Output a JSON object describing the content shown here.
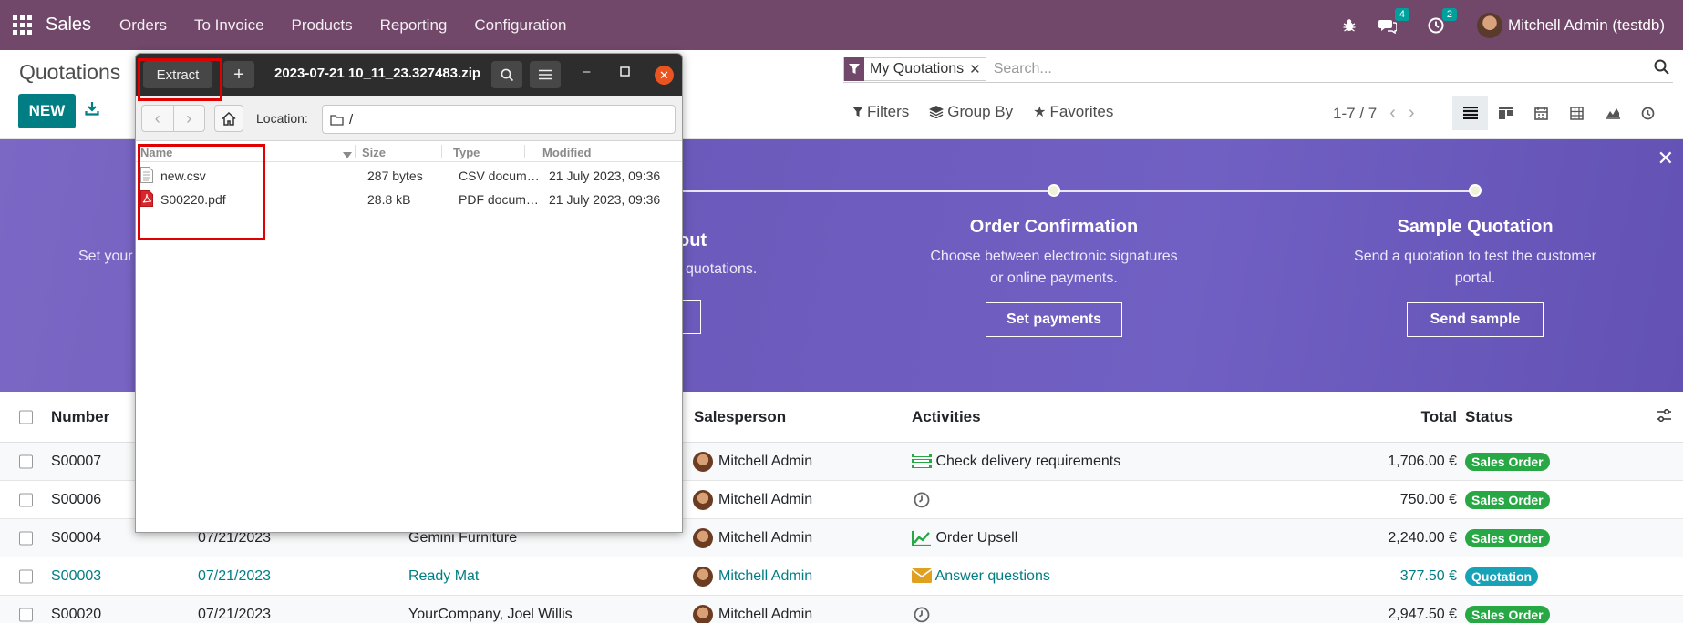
{
  "navbar": {
    "brand": "Sales",
    "menu": [
      "Orders",
      "To Invoice",
      "Products",
      "Reporting",
      "Configuration"
    ],
    "messages_count": "4",
    "activities_count": "2",
    "user": "Mitchell Admin (testdb)"
  },
  "control_panel": {
    "title": "Quotations",
    "new_label": "NEW",
    "facet": "My Quotations",
    "search_placeholder": "Search...",
    "filters_label": "Filters",
    "groupby_label": "Group By",
    "favorites_label": "Favorites",
    "pager": "1-7 / 7"
  },
  "banner": {
    "partial_left_text": "Set your",
    "partial_mid_title": "out",
    "partial_mid_desc": "quotations.",
    "steps": [
      {
        "title": "Order Confirmation",
        "desc1": "Choose between electronic signatures",
        "desc2": "or online payments.",
        "button": "Set payments"
      },
      {
        "title": "Sample Quotation",
        "desc1": "Send a quotation to test the customer",
        "desc2": "portal.",
        "button": "Send sample"
      }
    ]
  },
  "list": {
    "headers": {
      "number": "Number",
      "salesperson": "Salesperson",
      "activities": "Activities",
      "total": "Total",
      "status": "Status"
    },
    "rows": [
      {
        "number": "S00007",
        "date": "",
        "customer": "",
        "salesperson": "Mitchell Admin",
        "activity_icon": "truck-list-icon",
        "activity": "Check delivery requirements",
        "total": "1,706.00 €",
        "status": "Sales Order"
      },
      {
        "number": "S00006",
        "date": "",
        "customer": "",
        "salesperson": "Mitchell Admin",
        "activity_icon": "clock-icon",
        "activity": "",
        "total": "750.00 €",
        "status": "Sales Order"
      },
      {
        "number": "S00004",
        "date": "07/21/2023",
        "customer": "Gemini Furniture",
        "salesperson": "Mitchell Admin",
        "activity_icon": "chart-line-icon",
        "activity": "Order Upsell",
        "total": "2,240.00 €",
        "status": "Sales Order"
      },
      {
        "number": "S00003",
        "date": "07/21/2023",
        "customer": "Ready Mat",
        "salesperson": "Mitchell Admin",
        "activity_icon": "envelope-icon",
        "activity": "Answer questions",
        "total": "377.50 €",
        "status": "Quotation"
      },
      {
        "number": "S00020",
        "date": "07/21/2023",
        "customer": "YourCompany, Joel Willis",
        "salesperson": "Mitchell Admin",
        "activity_icon": "clock-icon",
        "activity": "",
        "total": "2,947.50 €",
        "status": "Sales Order"
      }
    ]
  },
  "archive_window": {
    "extract_label": "Extract",
    "add_label": "+",
    "title": "2023-07-21 10_11_23.327483.zip",
    "location_label": "Location:",
    "location_value": "/",
    "columns": [
      "Name",
      "Size",
      "Type",
      "Modified"
    ],
    "files": [
      {
        "name": "new.csv",
        "size": "287 bytes",
        "type": "CSV docum…",
        "modified": "21 July 2023, 09:36",
        "icon": "text-file-icon"
      },
      {
        "name": "S00220.pdf",
        "size": "28.8 kB",
        "type": "PDF docum…",
        "modified": "21 July 2023, 09:36",
        "icon": "pdf-file-icon"
      }
    ]
  },
  "colors": {
    "navbar": "#71476a",
    "primary": "#017e84",
    "banner": "#6c5abb",
    "success": "#28a745",
    "info": "#17a2b8",
    "highlight": "#e00000"
  }
}
